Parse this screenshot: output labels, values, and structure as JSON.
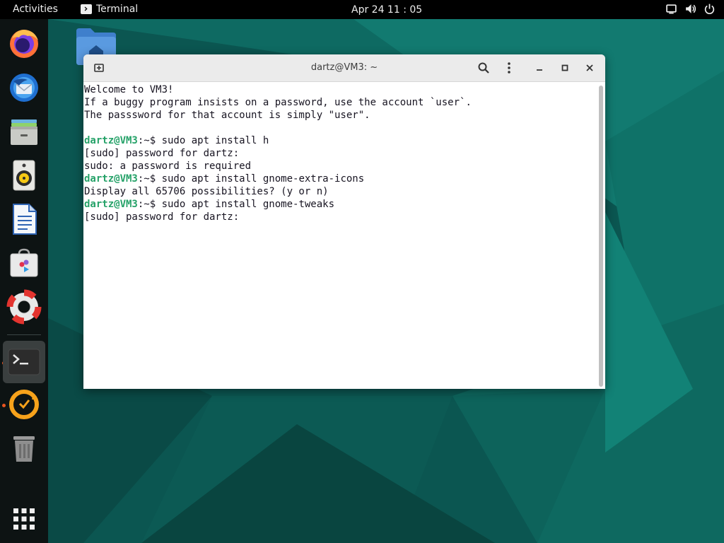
{
  "topbar": {
    "activities_label": "Activities",
    "app_menu_label": "Terminal",
    "clock": "Apr 24  11 : 05",
    "tray_icons": [
      "screen-icon",
      "volume-icon",
      "power-icon"
    ]
  },
  "dock": {
    "items": [
      {
        "name": "firefox-icon"
      },
      {
        "name": "thunderbird-icon"
      },
      {
        "name": "files-icon"
      },
      {
        "name": "rhythmbox-icon"
      },
      {
        "name": "libreoffice-writer-icon"
      },
      {
        "name": "software-icon"
      },
      {
        "name": "help-icon"
      },
      {
        "name": "terminal-icon",
        "active": true
      },
      {
        "name": "updates-icon"
      },
      {
        "name": "trash-icon"
      },
      {
        "name": "show-apps-icon"
      }
    ]
  },
  "window": {
    "title": "dartz@VM3: ~",
    "terminal_lines": [
      {
        "text": "Welcome to VM3!"
      },
      {
        "text": "If a buggy program insists on a password, use the account `user`."
      },
      {
        "text": "The passsword for that account is simply \"user\"."
      },
      {
        "text": ""
      },
      {
        "prompt_user": "dartz@VM3",
        "prompt_path": ":~$ ",
        "text": "sudo apt install h"
      },
      {
        "text": "[sudo] password for dartz: "
      },
      {
        "text": "sudo: a password is required"
      },
      {
        "prompt_user": "dartz@VM3",
        "prompt_path": ":~$ ",
        "text": "sudo apt install gnome-extra-icons"
      },
      {
        "text": "Display all 65706 possibilities? (y or n)"
      },
      {
        "prompt_user": "dartz@VM3",
        "prompt_path": ":~$ ",
        "text": "sudo apt install gnome-tweaks"
      },
      {
        "text": "[sudo] password for dartz: "
      }
    ]
  },
  "colors": {
    "prompt_green": "#26a269",
    "topbar_bg": "#000000",
    "dock_bg": "#0d1313",
    "desktop_teal": "#0a4f4a"
  }
}
